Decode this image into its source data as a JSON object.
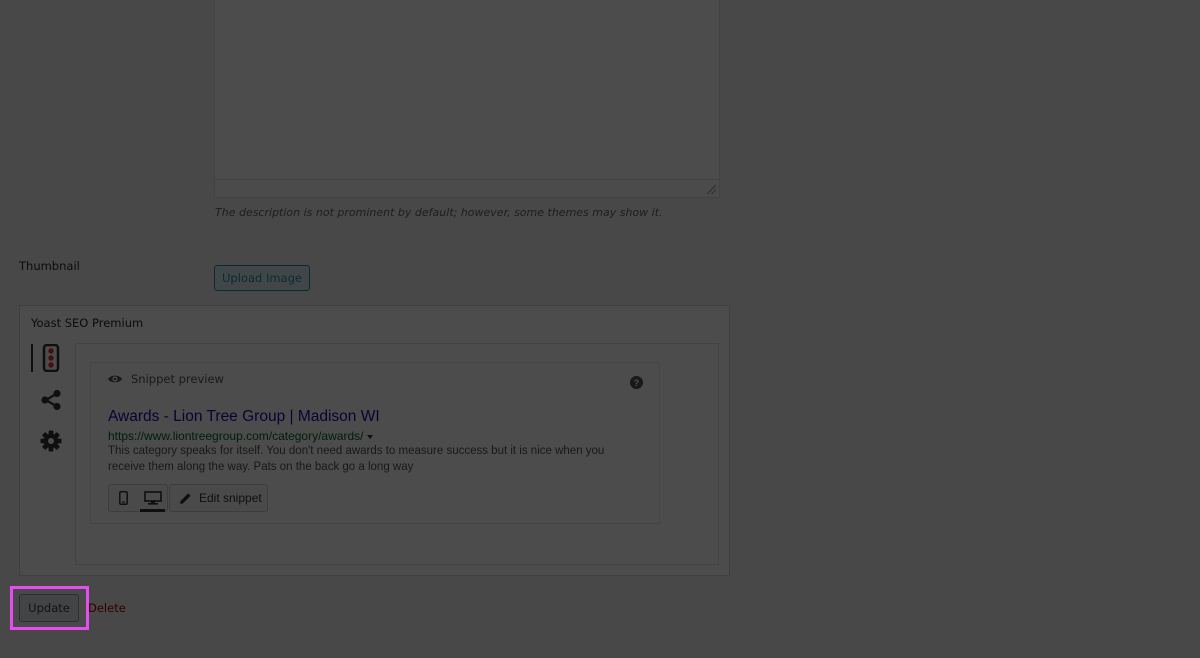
{
  "description": {
    "help_text": "The description is not prominent by default; however, some themes may show it."
  },
  "thumbnail": {
    "label": "Thumbnail",
    "upload_label": "Upload Image"
  },
  "yoast": {
    "title": "Yoast SEO Premium",
    "tabs": [
      {
        "icon": "traffic-light-icon",
        "active": true
      },
      {
        "icon": "share-icon",
        "active": false
      },
      {
        "icon": "gear-icon",
        "active": false
      }
    ],
    "snippet": {
      "header": "Snippet preview",
      "title": "Awards - Lion Tree Group | Madison WI",
      "url": "https://www.liontreegroup.com/category/awards/",
      "description": "This category speaks for itself. You don't need awards to measure success but it is nice when you receive them along the way. Pats on the back go a long way",
      "mode_selected": "desktop",
      "edit_label": "Edit snippet"
    }
  },
  "actions": {
    "update_label": "Update",
    "delete_label": "Delete"
  },
  "colors": {
    "overlay": "#000000",
    "highlight": "#e64df0",
    "link_title": "#1a0dab",
    "url_green": "#006621"
  }
}
